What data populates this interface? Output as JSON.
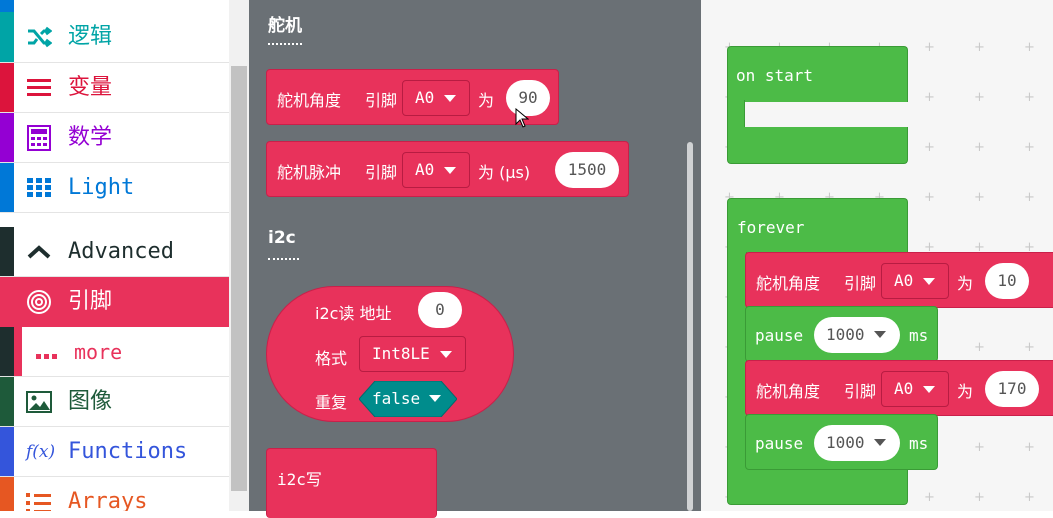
{
  "sidebar": {
    "categories": [
      {
        "label": "逻辑",
        "icon": "shuffle-icon",
        "color": "#00a4a6"
      },
      {
        "label": "变量",
        "icon": "list-lines-icon",
        "color": "#dc143c"
      },
      {
        "label": "数学",
        "icon": "calculator-icon",
        "color": "#9400d3"
      },
      {
        "label": "Light",
        "icon": "grid-dots-icon",
        "color": "#0078d7"
      },
      {
        "label": "Advanced",
        "icon": "chevron-up-icon",
        "color": "#1e2e2e"
      },
      {
        "label": "引脚",
        "icon": "target-icon",
        "color": "#e8325b"
      },
      {
        "label": "more",
        "icon": "dots-icon",
        "color": "#e8325b"
      },
      {
        "label": "图像",
        "icon": "image-icon",
        "color": "#1e5a3a"
      },
      {
        "label": "Functions",
        "icon": "function-icon",
        "color": "#3455db"
      },
      {
        "label": "Arrays",
        "icon": "list-numbered-icon",
        "color": "#e65722"
      }
    ]
  },
  "flyout": {
    "section1": "舵机",
    "block_servo_angle": {
      "label": "舵机角度",
      "pin_label": "引脚",
      "pin": "A0",
      "to": "为",
      "value": "90"
    },
    "block_servo_pulse": {
      "label": "舵机脉冲",
      "pin_label": "引脚",
      "pin": "A0",
      "to": "为 (μs)",
      "value": "1500"
    },
    "section2": "i2c",
    "block_i2c_read": {
      "label": "i2c读 地址",
      "addr": "0",
      "format_label": "格式",
      "format": "Int8LE",
      "repeat_label": "重复",
      "repeat": "false"
    },
    "block_i2c_write": {
      "label": "i2c写"
    }
  },
  "workspace": {
    "on_start": {
      "label": "on start"
    },
    "forever": {
      "label": "forever",
      "stmt1": {
        "label": "舵机角度",
        "pin_label": "引脚",
        "pin": "A0",
        "to": "为",
        "value": "10"
      },
      "pause1": {
        "label": "pause",
        "value": "1000",
        "unit": "ms"
      },
      "stmt2": {
        "label": "舵机角度",
        "pin_label": "引脚",
        "pin": "A0",
        "to": "为",
        "value": "170"
      },
      "pause2": {
        "label": "pause",
        "value": "1000",
        "unit": "ms"
      }
    }
  }
}
